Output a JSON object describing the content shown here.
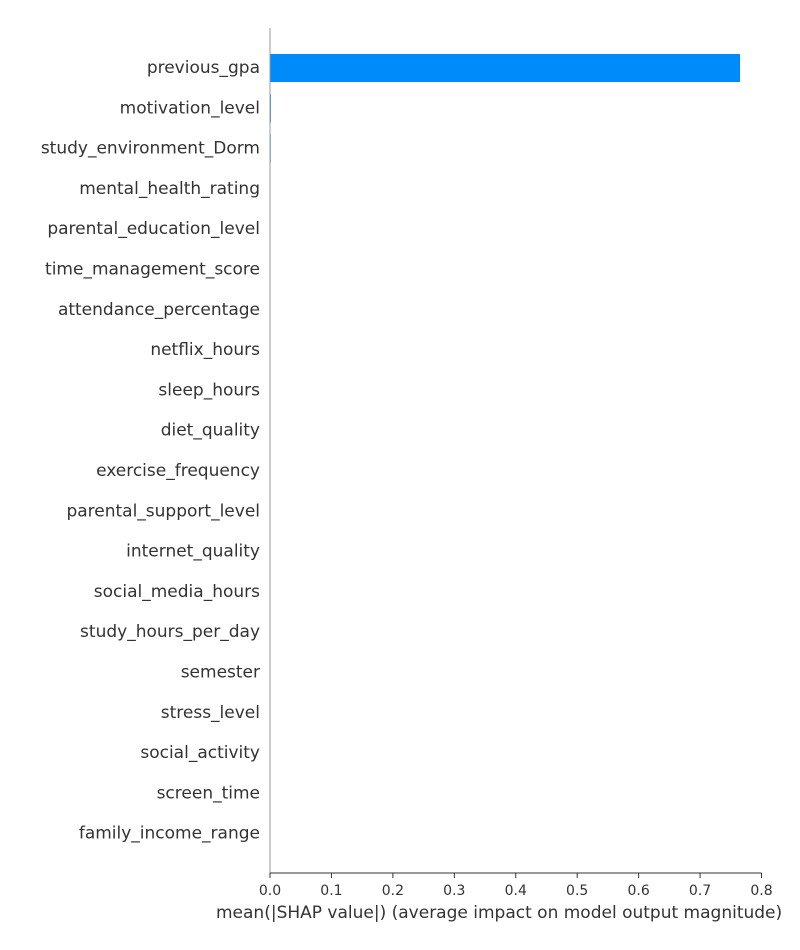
{
  "chart_data": {
    "type": "bar",
    "orientation": "horizontal",
    "title": "",
    "xlabel": "mean(|SHAP value|) (average impact on model output magnitude)",
    "ylabel": "",
    "xlim": [
      0,
      0.8
    ],
    "xticks": [
      0.0,
      0.1,
      0.2,
      0.3,
      0.4,
      0.5,
      0.6,
      0.7,
      0.8
    ],
    "xtick_labels": [
      "0.0",
      "0.1",
      "0.2",
      "0.3",
      "0.4",
      "0.5",
      "0.6",
      "0.7",
      "0.8"
    ],
    "bar_color": "#008bfb",
    "grid": false,
    "categories": [
      "previous_gpa",
      "motivation_level",
      "study_environment_Dorm",
      "mental_health_rating",
      "parental_education_level",
      "time_management_score",
      "attendance_percentage",
      "netflix_hours",
      "sleep_hours",
      "diet_quality",
      "exercise_frequency",
      "parental_support_level",
      "internet_quality",
      "social_media_hours",
      "study_hours_per_day",
      "semester",
      "stress_level",
      "social_activity",
      "screen_time",
      "family_income_range"
    ],
    "values": [
      0.765,
      0.0015,
      0.0012,
      0.0003,
      0.0002,
      0.0002,
      0.0001,
      0.0001,
      0.0001,
      0.0001,
      0.0001,
      0.0001,
      0.0001,
      0.0001,
      0.0001,
      0.0,
      0.0,
      0.0,
      0.0,
      0.0
    ]
  }
}
